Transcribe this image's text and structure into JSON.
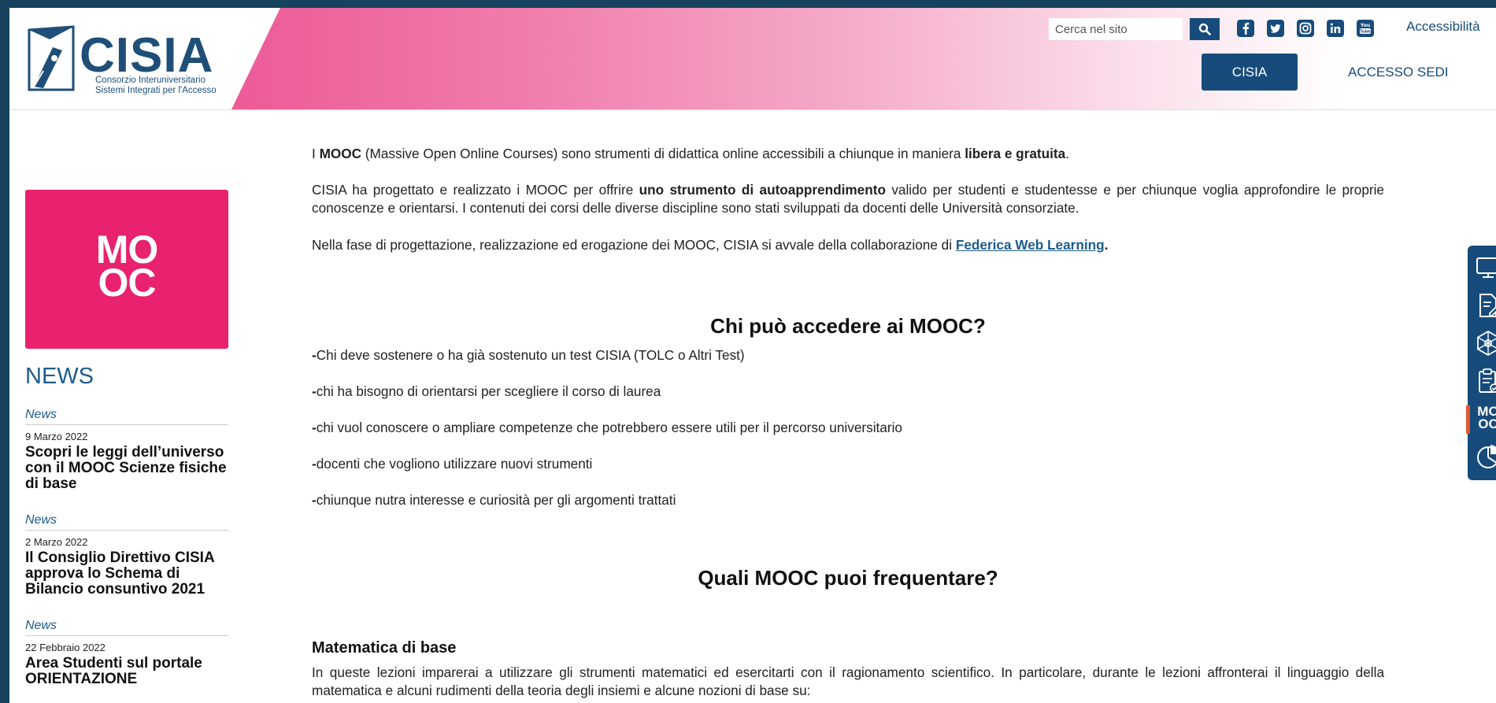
{
  "header": {
    "logo_text": "CISIA",
    "logo_subtitle_1": "Consorzio Interuniversitario",
    "logo_subtitle_2": "Sistemi Integrati per l'Accesso",
    "search_placeholder": "Cerca nel sito",
    "accessibility_label": "Accessibilità",
    "nav_cisia": "CISIA",
    "nav_accesso": "ACCESSO SEDI",
    "social_icons": [
      "facebook-icon",
      "twitter-icon",
      "instagram-icon",
      "linkedin-icon",
      "youtube-icon"
    ]
  },
  "sidebar": {
    "mooc_tile_line1": "MO",
    "mooc_tile_line2": "OC",
    "news_heading": "NEWS",
    "news": [
      {
        "category": "News",
        "date": "9 Marzo 2022",
        "title": "Scopri le leggi dell’universo con il MOOC Scienze fisiche di base"
      },
      {
        "category": "News",
        "date": "2 Marzo 2022",
        "title": "Il Consiglio Direttivo CISIA approva lo Schema di Bilancio consuntivo 2021"
      },
      {
        "category": "News",
        "date": "22 Febbraio 2022",
        "title": "Area Studenti sul portale ORIENTAZIONE"
      }
    ]
  },
  "main": {
    "p1": {
      "a": "I ",
      "b": "MOOC",
      "c": " (Massive Open Online Courses) sono strumenti di didattica online accessibili a chiunque in maniera ",
      "d": "libera e gratuita",
      "e": "."
    },
    "p2": {
      "a": "CISIA ha progettato e realizzato i MOOC per offrire ",
      "b": "uno strumento di autoapprendimento",
      "c": " valido per studenti e studentesse e per chiunque voglia approfondire le proprie conoscenze e orientarsi. I contenuti dei corsi delle diverse discipline sono stati sviluppati da docenti delle Università consorziate."
    },
    "p3": {
      "a": "Nella fase di progettazione, realizzazione ed erogazione dei MOOC, CISIA si avvale della collaborazione di ",
      "link": "Federica Web Learning",
      "b": "."
    },
    "heading_chi": "Chi può accedere ai MOOC?",
    "bullets": [
      "Chi deve sostenere o ha già sostenuto un test CISIA (TOLC o Altri Test)",
      "chi ha bisogno di orientarsi per scegliere il corso di laurea",
      "chi vuol conoscere o ampliare competenze che potrebbero essere utili per il percorso universitario",
      "docenti che vogliono utilizzare nuovi strumenti",
      "chiunque nutra interesse e curiosità per gli argomenti trattati"
    ],
    "bullet_prefix": "-",
    "heading_quali": "Quali MOOC puoi frequentare?",
    "heading_matematica": "Matematica di base",
    "p_matematica": "In queste lezioni imparerai a utilizzare gli strumenti matematici ed esercitarti con il ragionamento scientifico. In particolare, durante le lezioni affronterai il linguaggio della matematica e alcuni rudimenti della teoria degli insiemi e alcune nozioni di base su:"
  },
  "side_menu": {
    "items": [
      "monitor-icon",
      "document-edit-icon",
      "network-icon",
      "clipboard-check-icon",
      "mooc-icon",
      "pie-chart-icon"
    ],
    "mooc_line1": "MO",
    "mooc_line2": "OC",
    "active_color": "#e0572c"
  },
  "colors": {
    "brand_blue": "#174b7b",
    "mooc_pink": "#e8226f",
    "link_blue": "#1d5c8c"
  }
}
